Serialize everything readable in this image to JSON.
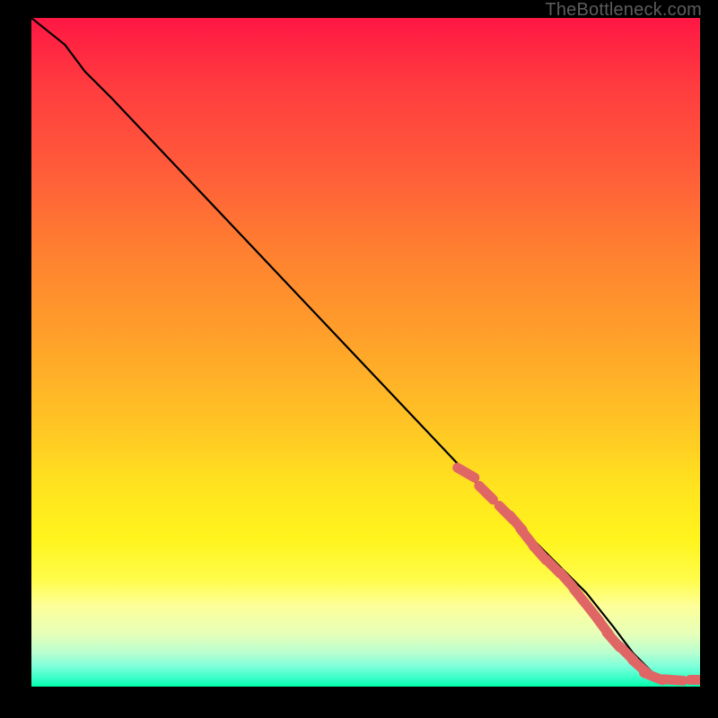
{
  "watermark": "TheBottleneck.com",
  "colors": {
    "background": "#000000",
    "curve": "#000000",
    "marker": "#e06666",
    "gradient_top": "#ff1744",
    "gradient_bottom": "#00ffaa"
  },
  "chart_data": {
    "type": "line",
    "title": "",
    "xlabel": "",
    "ylabel": "",
    "xlim": [
      0,
      100
    ],
    "ylim": [
      0,
      100
    ],
    "grid": false,
    "legend": false,
    "series": [
      {
        "name": "curve",
        "x": [
          0,
          5,
          8,
          12,
          65,
          72,
          78,
          83,
          87,
          90,
          93,
          96,
          100
        ],
        "y": [
          100,
          96,
          92,
          88,
          32,
          25,
          19,
          14,
          9,
          5,
          2,
          1,
          1
        ]
      }
    ],
    "markers": [
      {
        "x": 65,
        "y": 32
      },
      {
        "x": 68,
        "y": 29
      },
      {
        "x": 71,
        "y": 26
      },
      {
        "x": 72.5,
        "y": 24.5
      },
      {
        "x": 74,
        "y": 22.5
      },
      {
        "x": 76,
        "y": 20
      },
      {
        "x": 78,
        "y": 18
      },
      {
        "x": 80,
        "y": 16
      },
      {
        "x": 82,
        "y": 13.5
      },
      {
        "x": 84,
        "y": 11
      },
      {
        "x": 85.5,
        "y": 9
      },
      {
        "x": 87,
        "y": 7
      },
      {
        "x": 89,
        "y": 5
      },
      {
        "x": 91,
        "y": 3
      },
      {
        "x": 93,
        "y": 1.5
      },
      {
        "x": 96,
        "y": 1
      },
      {
        "x": 100,
        "y": 1
      }
    ]
  }
}
